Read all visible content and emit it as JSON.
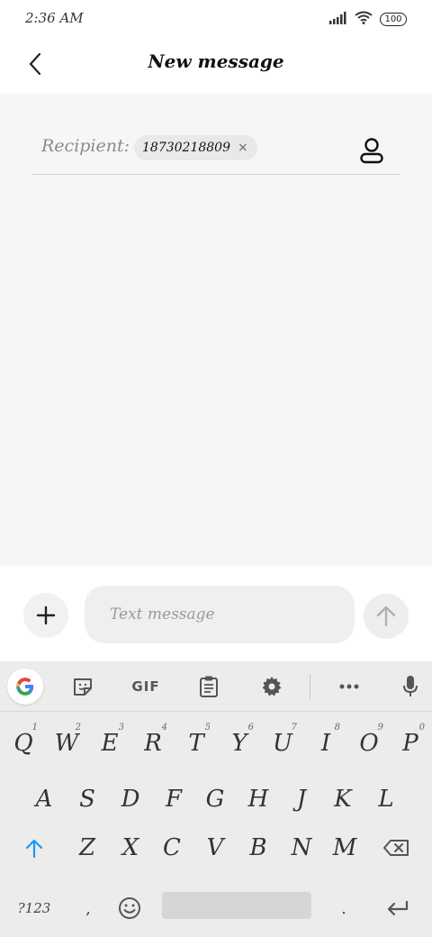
{
  "status_bar": {
    "time": "2:36 AM",
    "battery": "100"
  },
  "header": {
    "title": "New message"
  },
  "recipient": {
    "label": "Recipient:",
    "chip_text": "18730218809",
    "chip_close": "×"
  },
  "compose": {
    "placeholder": "Text message"
  },
  "keyboard": {
    "toolbar_gif": "GIF",
    "row1": [
      {
        "k": "Q",
        "h": "1"
      },
      {
        "k": "W",
        "h": "2"
      },
      {
        "k": "E",
        "h": "3"
      },
      {
        "k": "R",
        "h": "4"
      },
      {
        "k": "T",
        "h": "5"
      },
      {
        "k": "Y",
        "h": "6"
      },
      {
        "k": "U",
        "h": "7"
      },
      {
        "k": "I",
        "h": "8"
      },
      {
        "k": "O",
        "h": "9"
      },
      {
        "k": "P",
        "h": "0"
      }
    ],
    "row2": [
      "A",
      "S",
      "D",
      "F",
      "G",
      "H",
      "J",
      "K",
      "L"
    ],
    "row3": [
      "Z",
      "X",
      "C",
      "V",
      "B",
      "N",
      "M"
    ],
    "sym_label": "?123",
    "comma": ",",
    "period": "."
  },
  "colors": {
    "accent_blue": "#2196f3",
    "chip_bg": "#e9e9e9"
  }
}
